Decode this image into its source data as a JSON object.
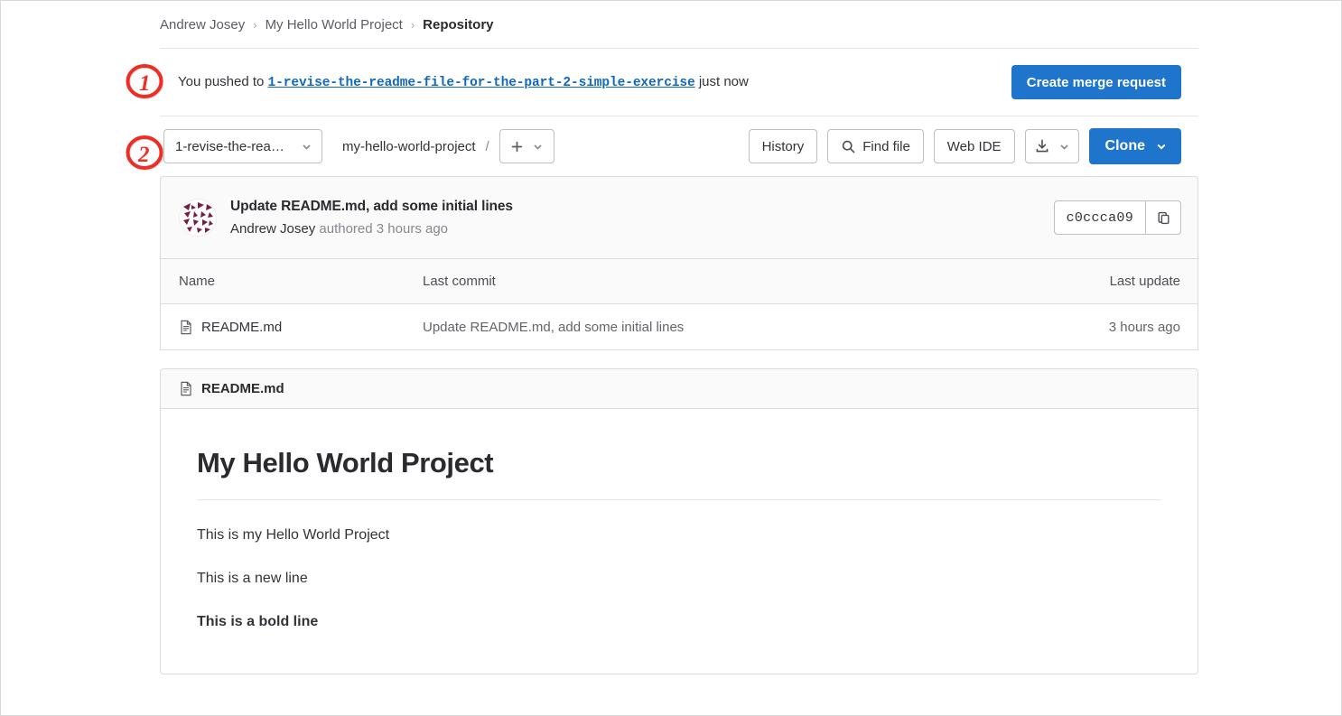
{
  "breadcrumb": {
    "owner": "Andrew Josey",
    "project": "My Hello World Project",
    "section": "Repository",
    "separator": "›"
  },
  "push_banner": {
    "prefix": "You pushed to",
    "branch": "1-revise-the-readme-file-for-the-part-2-simple-exercise",
    "suffix": "just now",
    "merge_request_button": "Create merge request"
  },
  "toolbar": {
    "branch_selector_value": "1-revise-the-rea…",
    "repo_path": "my-hello-world-project",
    "path_separator": "/",
    "add_button": "+",
    "history_label": "History",
    "find_file_label": "Find file",
    "web_ide_label": "Web IDE",
    "clone_label": "Clone"
  },
  "commit": {
    "title": "Update README.md, add some initial lines",
    "author": "Andrew Josey",
    "authored_text": "authored",
    "time_ago": "3 hours ago",
    "sha": "c0ccca09"
  },
  "file_table": {
    "columns": [
      "Name",
      "Last commit",
      "Last update"
    ],
    "rows": [
      {
        "name": "README.md",
        "last_commit": "Update README.md, add some initial lines",
        "last_update": "3 hours ago"
      }
    ]
  },
  "readme": {
    "filename": "README.md",
    "heading": "My Hello World Project",
    "lines": [
      {
        "text": "This is my Hello World Project",
        "bold": false
      },
      {
        "text": "This is a new line",
        "bold": false
      },
      {
        "text": "This is a bold line",
        "bold": true
      }
    ]
  },
  "annotations": [
    {
      "label": "1"
    },
    {
      "label": "2"
    }
  ],
  "colors": {
    "primary_blue": "#1f75cb",
    "link_blue": "#1068bf",
    "annotation_red": "#ee2d24",
    "avatar_maroon": "#76203f"
  }
}
